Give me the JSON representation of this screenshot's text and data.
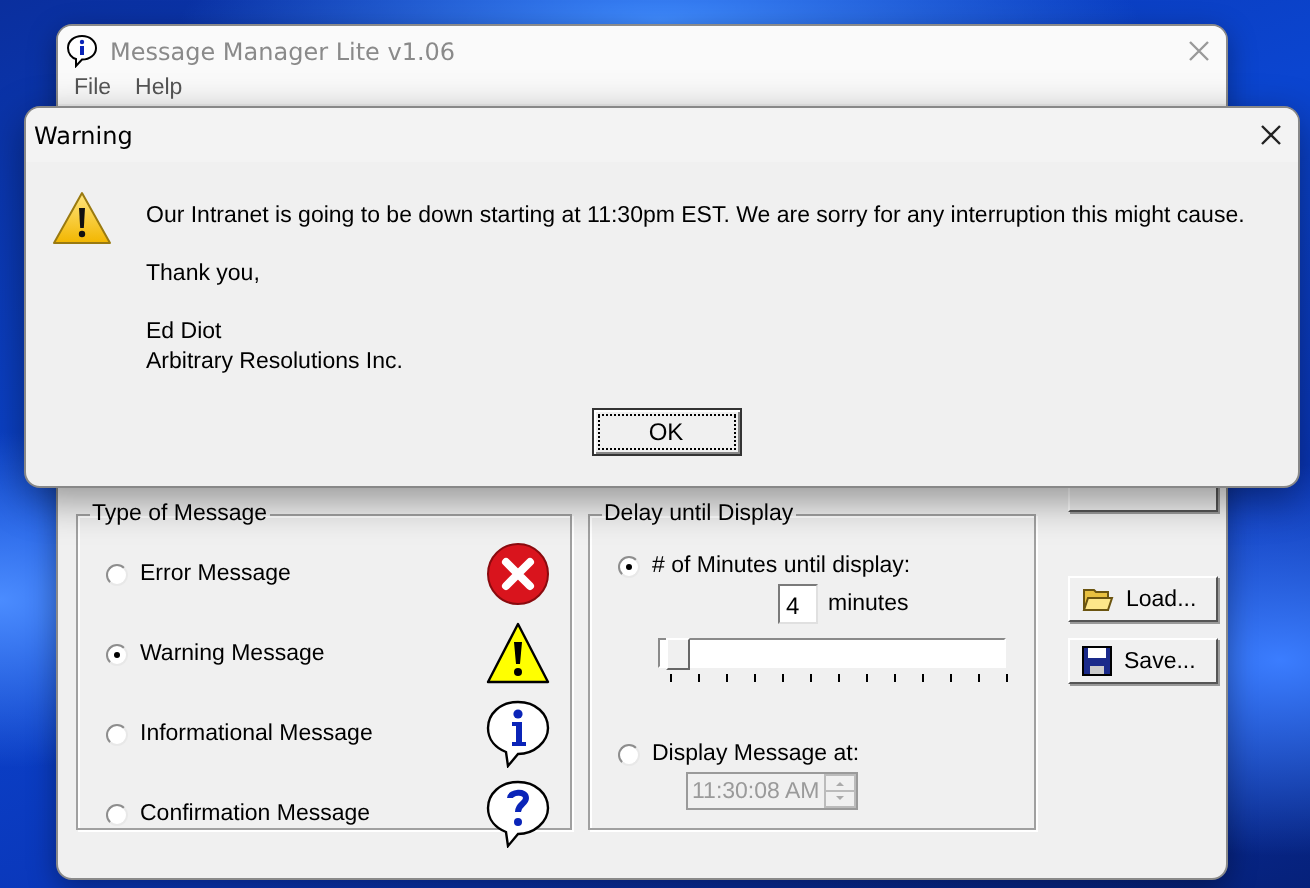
{
  "main_window": {
    "title": "Message Manager Lite v1.06",
    "menu": [
      "File",
      "Help"
    ],
    "message_type": {
      "title": "Type of Message",
      "options": [
        {
          "label": "Error Message",
          "kind": "error",
          "selected": false
        },
        {
          "label": "Warning Message",
          "kind": "warning",
          "selected": true
        },
        {
          "label": "Informational Message",
          "kind": "info",
          "selected": false
        },
        {
          "label": "Confirmation Message",
          "kind": "question",
          "selected": false
        }
      ]
    },
    "delay": {
      "title": "Delay until Display",
      "minutes_option": {
        "label": "# of Minutes until display:",
        "selected": true
      },
      "minutes_value": "4",
      "minutes_unit": "minutes",
      "slider": {
        "level": 0.02
      },
      "time_option": {
        "label": "Display Message at:",
        "selected": false
      },
      "time_field": {
        "value": "11:30:08 AM",
        "disabled": true
      }
    },
    "buttons": [
      {
        "kind": "preview"
      },
      {
        "label": "Load...",
        "kind": "load"
      },
      {
        "label": "Save...",
        "kind": "save"
      }
    ]
  },
  "dialog": {
    "title": "Warning",
    "kind": "warning",
    "paragraphs": [
      [
        "Our Intranet is going to be down starting at 11:30pm EST. We are sorry for any interruption this might cause."
      ],
      [
        "Thank you,"
      ],
      [
        "Ed Diot",
        "Arbitrary Resolutions Inc."
      ]
    ],
    "button": "OK"
  }
}
